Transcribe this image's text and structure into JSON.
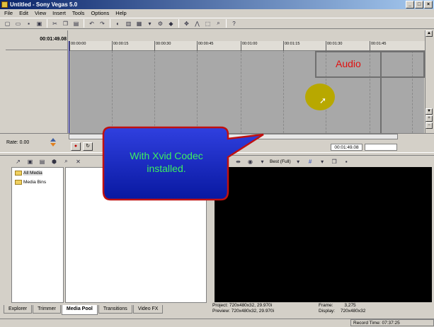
{
  "window": {
    "title": "Untitled - Sony Vegas 5.0"
  },
  "menu": [
    "File",
    "Edit",
    "View",
    "Insert",
    "Tools",
    "Options",
    "Help"
  ],
  "timeline": {
    "cursor_time": "00:01:49.08",
    "ruler_ticks": [
      "00:00:00",
      "00:00:15",
      "00:00:30",
      "00:00:45",
      "00:01:00",
      "00:01:15",
      "00:01:30",
      "00:01:45"
    ],
    "annotation_label": "Audio"
  },
  "transport": {
    "rate_label": "Rate: 0.00",
    "time_readout": "00:01:49.08"
  },
  "explorer": {
    "tree": [
      "All Media",
      "Media Bins"
    ],
    "tabs": [
      "Explorer",
      "Trimmer",
      "Media Pool",
      "Transitions",
      "Video FX"
    ],
    "active_tab": "Media Pool"
  },
  "preview": {
    "quality": "Best (Full)",
    "project_label": "Project:",
    "project_value": "720x480x32, 29.970i",
    "preview_label": "Preview:",
    "preview_value": "720x480x32, 29.970i",
    "frame_label": "Frame:",
    "frame_value": "3,275",
    "display_label": "Display:",
    "display_value": "720x480x32"
  },
  "status": {
    "record_time": "Record Time: 07:37:25"
  },
  "callout": {
    "line1": "With Xvid Codec",
    "line2": "installed."
  },
  "colors": {
    "callout_fill": "#1020c0",
    "callout_border": "#c01010",
    "callout_text": "#3cf060",
    "audio_text": "#e01010",
    "highlight": "#b8a800"
  }
}
